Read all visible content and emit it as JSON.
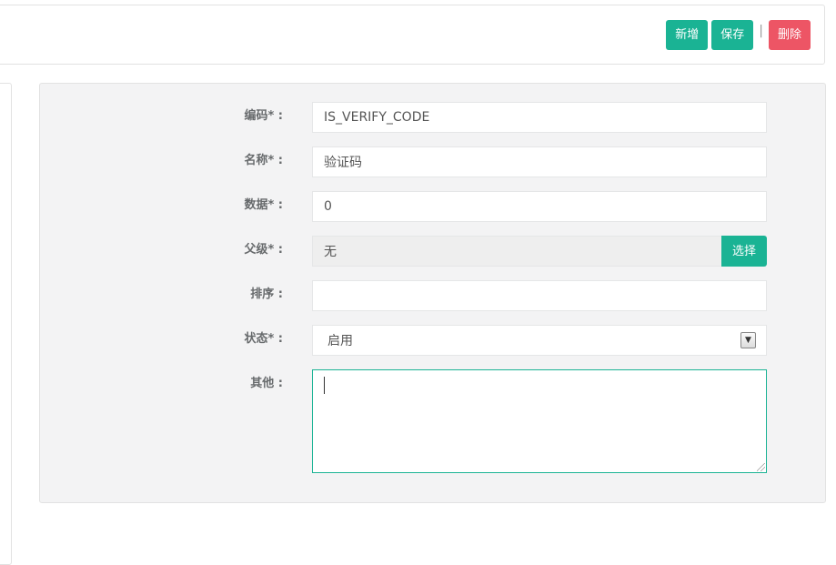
{
  "toolbar": {
    "add_label": "新增",
    "save_label": "保存",
    "separator": "|",
    "delete_label": "删除"
  },
  "form": {
    "code": {
      "label": "编码* :",
      "value": "IS_VERIFY_CODE"
    },
    "name": {
      "label": "名称* :",
      "value": "验证码"
    },
    "data": {
      "label": "数据* :",
      "value": "0"
    },
    "parent": {
      "label": "父级* :",
      "value": "无",
      "pick_label": "选择"
    },
    "sort": {
      "label": "排序 :",
      "value": ""
    },
    "status": {
      "label": "状态* :",
      "selected": "启用"
    },
    "other": {
      "label": "其他 :",
      "value": ""
    }
  },
  "colors": {
    "primary": "#1ab394",
    "danger": "#ed5565",
    "panel_bg": "#f3f3f4"
  }
}
